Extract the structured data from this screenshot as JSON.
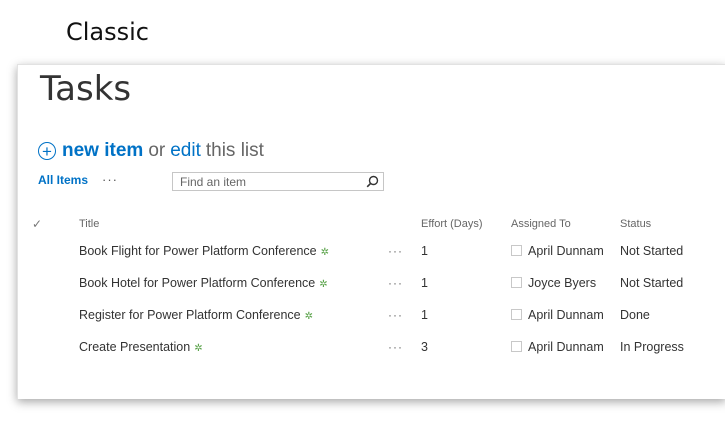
{
  "caption": "Classic",
  "page": {
    "title": "Tasks"
  },
  "toolbar": {
    "new_item_label": "new item",
    "or_text": "or",
    "edit_label": "edit",
    "this_list_text": "this list"
  },
  "view": {
    "name": "All Items",
    "more": "···",
    "search_placeholder": "Find an item"
  },
  "columns": {
    "title": "Title",
    "effort": "Effort (Days)",
    "assigned": "Assigned To",
    "status": "Status"
  },
  "rows": [
    {
      "title": "Book Flight for Power Platform Conference",
      "effort": "1",
      "assigned": "April Dunnam",
      "status": "Not Started"
    },
    {
      "title": "Book Hotel for Power Platform Conference",
      "effort": "1",
      "assigned": "Joyce Byers",
      "status": "Not Started"
    },
    {
      "title": "Register for Power Platform Conference",
      "effort": "1",
      "assigned": "April Dunnam",
      "status": "Done"
    },
    {
      "title": "Create Presentation",
      "effort": "3",
      "assigned": "April Dunnam",
      "status": "In Progress"
    }
  ],
  "icons": {
    "new_marker": "new-item-marker-icon",
    "search": "search-icon",
    "check": "check-icon",
    "add": "plus-circle-icon"
  },
  "colors": {
    "link": "#0072c6",
    "new_marker": "#5aa34a"
  }
}
